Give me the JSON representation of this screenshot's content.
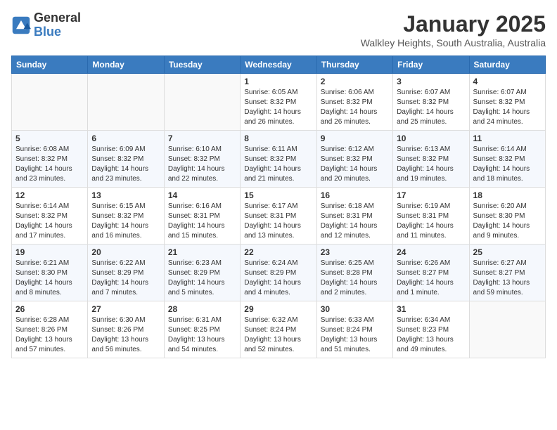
{
  "logo": {
    "general": "General",
    "blue": "Blue"
  },
  "header": {
    "month": "January 2025",
    "location": "Walkley Heights, South Australia, Australia"
  },
  "weekdays": [
    "Sunday",
    "Monday",
    "Tuesday",
    "Wednesday",
    "Thursday",
    "Friday",
    "Saturday"
  ],
  "weeks": [
    [
      {
        "day": "",
        "sunrise": "",
        "sunset": "",
        "daylight": ""
      },
      {
        "day": "",
        "sunrise": "",
        "sunset": "",
        "daylight": ""
      },
      {
        "day": "",
        "sunrise": "",
        "sunset": "",
        "daylight": ""
      },
      {
        "day": "1",
        "sunrise": "Sunrise: 6:05 AM",
        "sunset": "Sunset: 8:32 PM",
        "daylight": "Daylight: 14 hours and 26 minutes."
      },
      {
        "day": "2",
        "sunrise": "Sunrise: 6:06 AM",
        "sunset": "Sunset: 8:32 PM",
        "daylight": "Daylight: 14 hours and 26 minutes."
      },
      {
        "day": "3",
        "sunrise": "Sunrise: 6:07 AM",
        "sunset": "Sunset: 8:32 PM",
        "daylight": "Daylight: 14 hours and 25 minutes."
      },
      {
        "day": "4",
        "sunrise": "Sunrise: 6:07 AM",
        "sunset": "Sunset: 8:32 PM",
        "daylight": "Daylight: 14 hours and 24 minutes."
      }
    ],
    [
      {
        "day": "5",
        "sunrise": "Sunrise: 6:08 AM",
        "sunset": "Sunset: 8:32 PM",
        "daylight": "Daylight: 14 hours and 23 minutes."
      },
      {
        "day": "6",
        "sunrise": "Sunrise: 6:09 AM",
        "sunset": "Sunset: 8:32 PM",
        "daylight": "Daylight: 14 hours and 23 minutes."
      },
      {
        "day": "7",
        "sunrise": "Sunrise: 6:10 AM",
        "sunset": "Sunset: 8:32 PM",
        "daylight": "Daylight: 14 hours and 22 minutes."
      },
      {
        "day": "8",
        "sunrise": "Sunrise: 6:11 AM",
        "sunset": "Sunset: 8:32 PM",
        "daylight": "Daylight: 14 hours and 21 minutes."
      },
      {
        "day": "9",
        "sunrise": "Sunrise: 6:12 AM",
        "sunset": "Sunset: 8:32 PM",
        "daylight": "Daylight: 14 hours and 20 minutes."
      },
      {
        "day": "10",
        "sunrise": "Sunrise: 6:13 AM",
        "sunset": "Sunset: 8:32 PM",
        "daylight": "Daylight: 14 hours and 19 minutes."
      },
      {
        "day": "11",
        "sunrise": "Sunrise: 6:14 AM",
        "sunset": "Sunset: 8:32 PM",
        "daylight": "Daylight: 14 hours and 18 minutes."
      }
    ],
    [
      {
        "day": "12",
        "sunrise": "Sunrise: 6:14 AM",
        "sunset": "Sunset: 8:32 PM",
        "daylight": "Daylight: 14 hours and 17 minutes."
      },
      {
        "day": "13",
        "sunrise": "Sunrise: 6:15 AM",
        "sunset": "Sunset: 8:32 PM",
        "daylight": "Daylight: 14 hours and 16 minutes."
      },
      {
        "day": "14",
        "sunrise": "Sunrise: 6:16 AM",
        "sunset": "Sunset: 8:31 PM",
        "daylight": "Daylight: 14 hours and 15 minutes."
      },
      {
        "day": "15",
        "sunrise": "Sunrise: 6:17 AM",
        "sunset": "Sunset: 8:31 PM",
        "daylight": "Daylight: 14 hours and 13 minutes."
      },
      {
        "day": "16",
        "sunrise": "Sunrise: 6:18 AM",
        "sunset": "Sunset: 8:31 PM",
        "daylight": "Daylight: 14 hours and 12 minutes."
      },
      {
        "day": "17",
        "sunrise": "Sunrise: 6:19 AM",
        "sunset": "Sunset: 8:31 PM",
        "daylight": "Daylight: 14 hours and 11 minutes."
      },
      {
        "day": "18",
        "sunrise": "Sunrise: 6:20 AM",
        "sunset": "Sunset: 8:30 PM",
        "daylight": "Daylight: 14 hours and 9 minutes."
      }
    ],
    [
      {
        "day": "19",
        "sunrise": "Sunrise: 6:21 AM",
        "sunset": "Sunset: 8:30 PM",
        "daylight": "Daylight: 14 hours and 8 minutes."
      },
      {
        "day": "20",
        "sunrise": "Sunrise: 6:22 AM",
        "sunset": "Sunset: 8:29 PM",
        "daylight": "Daylight: 14 hours and 7 minutes."
      },
      {
        "day": "21",
        "sunrise": "Sunrise: 6:23 AM",
        "sunset": "Sunset: 8:29 PM",
        "daylight": "Daylight: 14 hours and 5 minutes."
      },
      {
        "day": "22",
        "sunrise": "Sunrise: 6:24 AM",
        "sunset": "Sunset: 8:29 PM",
        "daylight": "Daylight: 14 hours and 4 minutes."
      },
      {
        "day": "23",
        "sunrise": "Sunrise: 6:25 AM",
        "sunset": "Sunset: 8:28 PM",
        "daylight": "Daylight: 14 hours and 2 minutes."
      },
      {
        "day": "24",
        "sunrise": "Sunrise: 6:26 AM",
        "sunset": "Sunset: 8:27 PM",
        "daylight": "Daylight: 14 hours and 1 minute."
      },
      {
        "day": "25",
        "sunrise": "Sunrise: 6:27 AM",
        "sunset": "Sunset: 8:27 PM",
        "daylight": "Daylight: 13 hours and 59 minutes."
      }
    ],
    [
      {
        "day": "26",
        "sunrise": "Sunrise: 6:28 AM",
        "sunset": "Sunset: 8:26 PM",
        "daylight": "Daylight: 13 hours and 57 minutes."
      },
      {
        "day": "27",
        "sunrise": "Sunrise: 6:30 AM",
        "sunset": "Sunset: 8:26 PM",
        "daylight": "Daylight: 13 hours and 56 minutes."
      },
      {
        "day": "28",
        "sunrise": "Sunrise: 6:31 AM",
        "sunset": "Sunset: 8:25 PM",
        "daylight": "Daylight: 13 hours and 54 minutes."
      },
      {
        "day": "29",
        "sunrise": "Sunrise: 6:32 AM",
        "sunset": "Sunset: 8:24 PM",
        "daylight": "Daylight: 13 hours and 52 minutes."
      },
      {
        "day": "30",
        "sunrise": "Sunrise: 6:33 AM",
        "sunset": "Sunset: 8:24 PM",
        "daylight": "Daylight: 13 hours and 51 minutes."
      },
      {
        "day": "31",
        "sunrise": "Sunrise: 6:34 AM",
        "sunset": "Sunset: 8:23 PM",
        "daylight": "Daylight: 13 hours and 49 minutes."
      },
      {
        "day": "",
        "sunrise": "",
        "sunset": "",
        "daylight": ""
      }
    ]
  ]
}
